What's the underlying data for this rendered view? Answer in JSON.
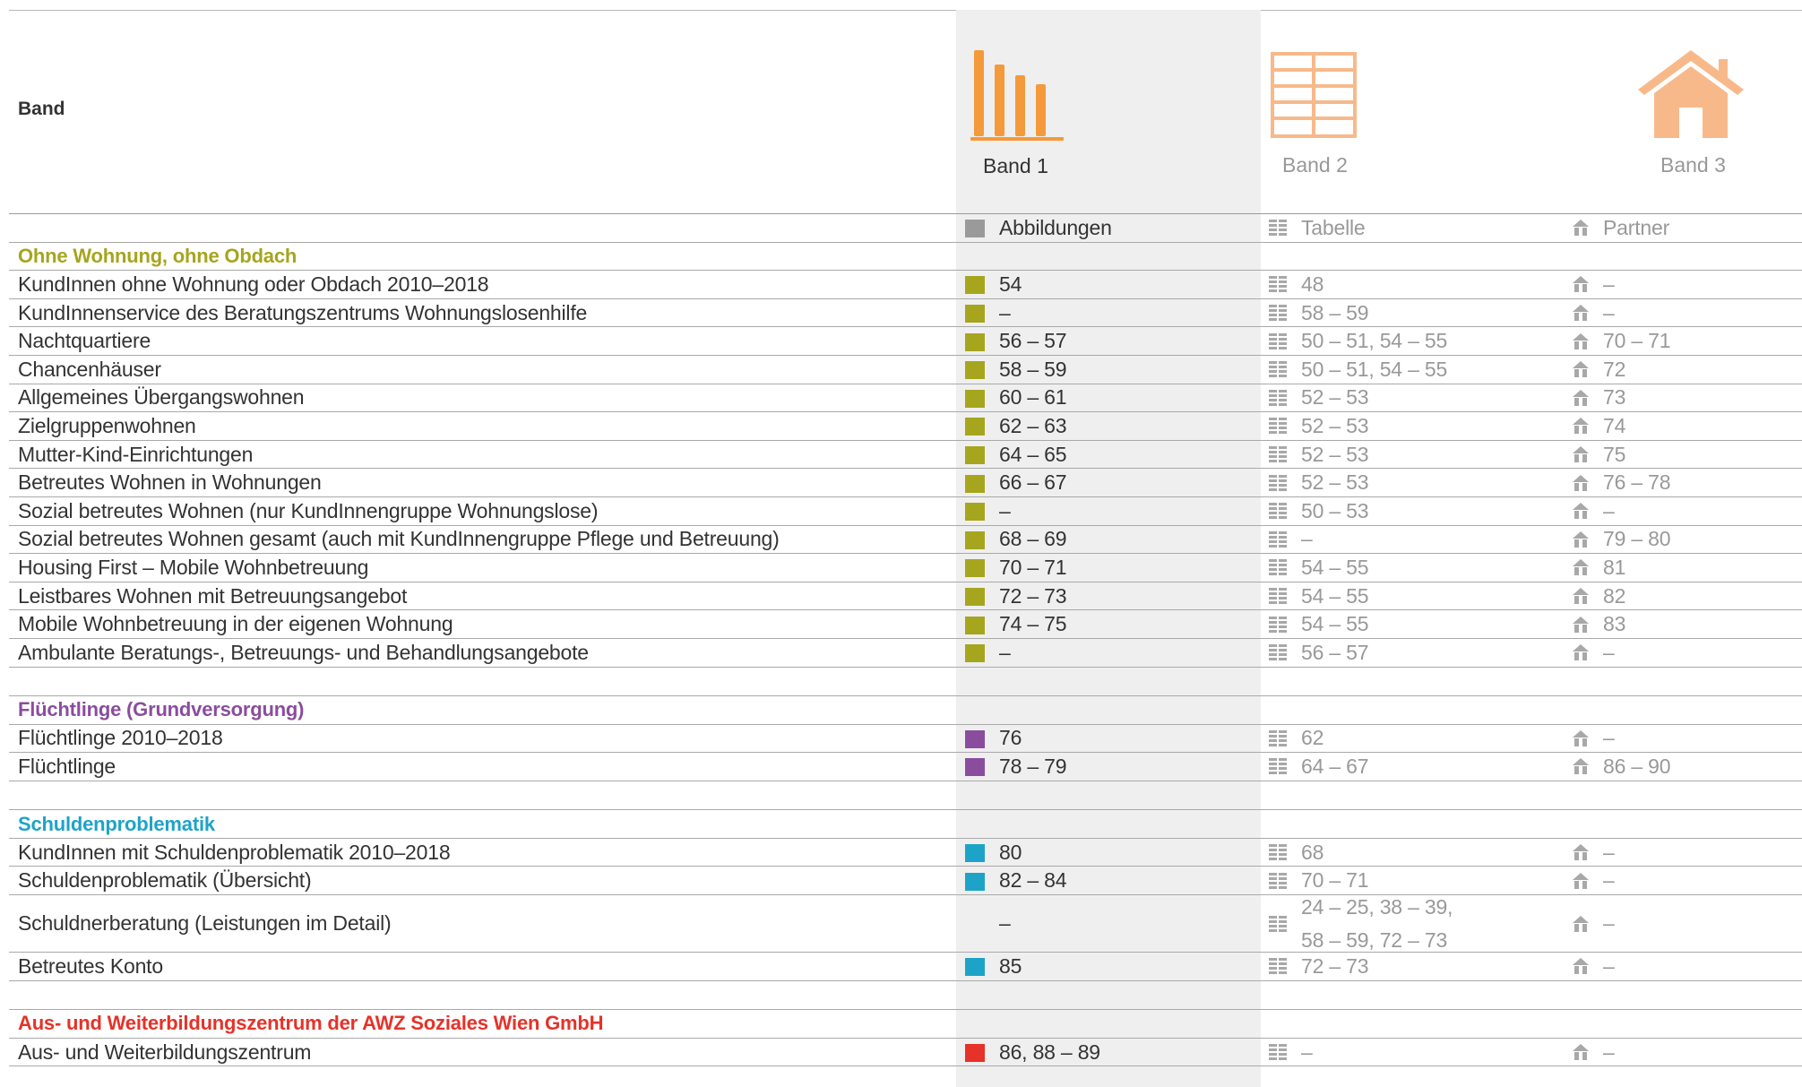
{
  "header": {
    "title": "Band",
    "bands": [
      {
        "label": "Band 1",
        "color": "#f49a3a",
        "icon": "bar-chart-icon"
      },
      {
        "label": "Band 2",
        "color": "#f8b98a",
        "icon": "table-icon"
      },
      {
        "label": "Band 3",
        "color": "#f8b98a",
        "icon": "house-icon"
      }
    ]
  },
  "columns": {
    "b1": "Abbildungen",
    "b2": "Tabelle",
    "b3": "Partner"
  },
  "colors": {
    "olive": "#a6a51e",
    "purple": "#8a4d9e",
    "cyan": "#1ea3c8",
    "red": "#e63228",
    "gray_icon": "#9a9a9a"
  },
  "sections": [
    {
      "title": "Ohne Wohnung, ohne Obdach",
      "color": "#a6a51e",
      "rows": [
        {
          "label": "KundInnen ohne Wohnung oder Obdach 2010–2018",
          "b1": "54",
          "b2": "48",
          "b3": "–"
        },
        {
          "label": "KundInnenservice des Beratungszentrums Wohnungslosenhilfe",
          "b1": "–",
          "b2": "58 – 59",
          "b3": "–"
        },
        {
          "label": "Nachtquartiere",
          "b1": "56 – 57",
          "b2": "50 – 51, 54 – 55",
          "b3": "70 – 71"
        },
        {
          "label": "Chancenhäuser",
          "b1": "58 – 59",
          "b2": "50 – 51, 54 – 55",
          "b3": "72"
        },
        {
          "label": "Allgemeines Übergangswohnen",
          "b1": "60 – 61",
          "b2": "52 – 53",
          "b3": "73"
        },
        {
          "label": "Zielgruppenwohnen",
          "b1": "62 – 63",
          "b2": "52 – 53",
          "b3": "74"
        },
        {
          "label": "Mutter-Kind-Einrichtungen",
          "b1": "64 – 65",
          "b2": "52 – 53",
          "b3": "75"
        },
        {
          "label": "Betreutes Wohnen in Wohnungen",
          "b1": "66 – 67",
          "b2": "52 – 53",
          "b3": "76 – 78"
        },
        {
          "label": "Sozial betreutes Wohnen (nur KundInnengruppe Wohnungslose)",
          "b1": "–",
          "b2": "50 – 53",
          "b3": "–"
        },
        {
          "label": "Sozial betreutes Wohnen gesamt (auch mit KundInnengruppe Pflege und Betreuung)",
          "b1": "68 – 69",
          "b2": "–",
          "b3": "79 – 80"
        },
        {
          "label": "Housing First – Mobile Wohnbetreuung",
          "b1": "70 – 71",
          "b2": "54 – 55",
          "b3": "81"
        },
        {
          "label": "Leistbares Wohnen mit Betreuungsangebot",
          "b1": "72 – 73",
          "b2": "54 – 55",
          "b3": "82"
        },
        {
          "label": "Mobile Wohnbetreuung in der eigenen Wohnung",
          "b1": "74 – 75",
          "b2": "54 – 55",
          "b3": "83"
        },
        {
          "label": "Ambulante Beratungs-, Betreuungs- und Behandlungsangebote",
          "b1": "–",
          "b2": "56 – 57",
          "b3": "–"
        }
      ]
    },
    {
      "title": "Flüchtlinge (Grundversorgung)",
      "color": "#8a4d9e",
      "rows": [
        {
          "label": "Flüchtlinge 2010–2018",
          "b1": "76",
          "b2": "62",
          "b3": "–"
        },
        {
          "label": "Flüchtlinge",
          "b1": "78 – 79",
          "b2": "64 – 67",
          "b3": "86 – 90"
        }
      ]
    },
    {
      "title": "Schuldenproblematik",
      "color": "#1ea3c8",
      "rows": [
        {
          "label": "KundInnen mit Schuldenproblematik 2010–2018",
          "b1": "80",
          "b2": "68",
          "b3": "–"
        },
        {
          "label": "Schuldenproblematik (Übersicht)",
          "b1": "82 – 84",
          "b2": "70 – 71",
          "b3": "–"
        },
        {
          "label": "Schuldnerberatung (Leistungen im Detail)",
          "b1": "–",
          "b2": "24 – 25, 38 – 39,",
          "b2_line2": "58 – 59, 72 – 73",
          "b3": "–",
          "no_b1_icon": true
        },
        {
          "label": "Betreutes Konto",
          "b1": "85",
          "b2": "72 – 73",
          "b3": "–"
        }
      ]
    },
    {
      "title": "Aus- und Weiterbildungszentrum der AWZ Soziales Wien GmbH",
      "color": "#e63228",
      "rows": [
        {
          "label": "Aus- und Weiterbildungszentrum",
          "b1": "86, 88 – 89",
          "b2": "–",
          "b3": "–"
        }
      ]
    }
  ]
}
